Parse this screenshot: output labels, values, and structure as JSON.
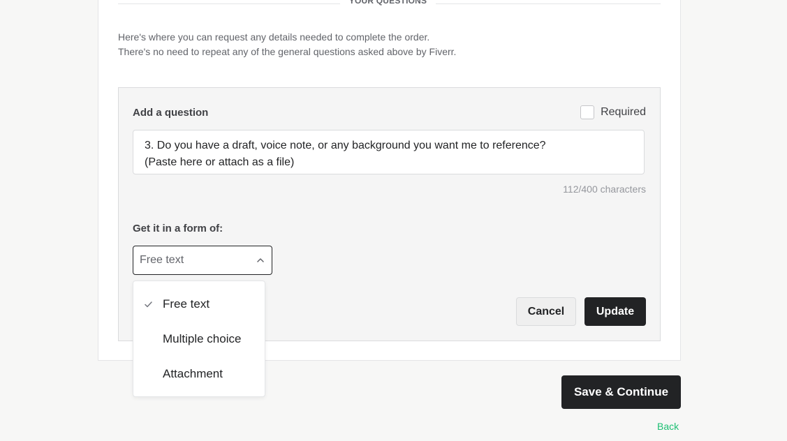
{
  "section": {
    "title": "YOUR QUESTIONS",
    "intro_line1": "Here's where you can request any details needed to complete the order.",
    "intro_line2": "There's no need to repeat any of the general questions asked above by Fiverr."
  },
  "question_editor": {
    "heading": "Add a question",
    "required_label": "Required",
    "required_checked": false,
    "question_line1": "3. Do you have a draft, voice note, or any background you want me to reference?",
    "question_line2": "(Paste here or attach as a file)",
    "char_count": "112/400 characters",
    "form_label": "Get it in a form of:",
    "form_type_value": "Free text",
    "form_type_options": [
      "Free text",
      "Multiple choice",
      "Attachment"
    ],
    "selected_option_index": 0,
    "cancel_label": "Cancel",
    "update_label": "Update"
  },
  "footer": {
    "save_label": "Save & Continue",
    "back_label": "Back"
  },
  "icons": {
    "check": "check-icon",
    "chevron": "chevron-up-icon"
  },
  "colors": {
    "primary_dark": "#222325",
    "link_green": "#1dbf73",
    "panel_bg": "#f5f5f5"
  }
}
